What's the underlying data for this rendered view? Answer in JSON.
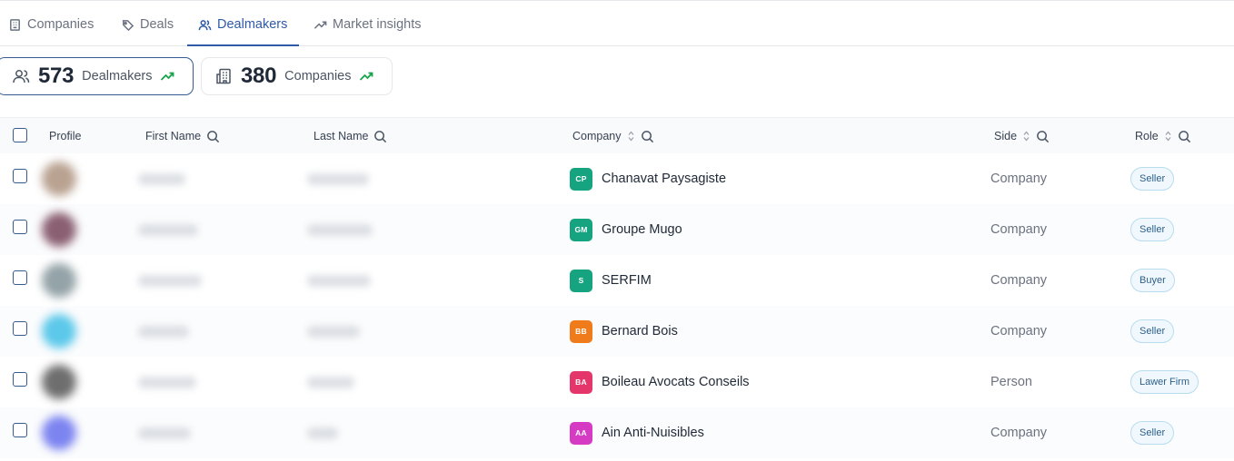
{
  "tabs": [
    {
      "label": "Companies",
      "icon": "building-icon"
    },
    {
      "label": "Deals",
      "icon": "tag-icon"
    },
    {
      "label": "Dealmakers",
      "icon": "users-icon",
      "active": true
    },
    {
      "label": "Market insights",
      "icon": "trend-icon"
    }
  ],
  "stats": {
    "dealmakers": {
      "value": "573",
      "label": "Dealmakers"
    },
    "companies": {
      "value": "380",
      "label": "Companies"
    }
  },
  "table": {
    "columns": {
      "profile": "Profile",
      "first_name": "First Name",
      "last_name": "Last Name",
      "company": "Company",
      "side": "Side",
      "role": "Role"
    },
    "rows": [
      {
        "logo_initials": "CP",
        "logo_color": "#16a37f",
        "company": "Chanavat Paysagiste",
        "side": "Company",
        "role": "Seller",
        "avatar_color": "#b9a291"
      },
      {
        "logo_initials": "GM",
        "logo_color": "#16a37f",
        "company": "Groupe Mugo",
        "side": "Company",
        "role": "Seller",
        "avatar_color": "#8a5f72"
      },
      {
        "logo_initials": "S",
        "logo_color": "#16a37f",
        "company": "SERFIM",
        "side": "Company",
        "role": "Buyer",
        "avatar_color": "#94a3a8"
      },
      {
        "logo_initials": "BB",
        "logo_color": "#f07b1a",
        "company": "Bernard Bois",
        "side": "Company",
        "role": "Seller",
        "avatar_color": "#5cc8ea"
      },
      {
        "logo_initials": "BA",
        "logo_color": "#e5366b",
        "company": "Boileau Avocats Conseils",
        "side": "Person",
        "role": "Lawer Firm",
        "avatar_color": "#6e6e6e"
      },
      {
        "logo_initials": "AA",
        "logo_color": "#d63bc4",
        "company": "Ain Anti-Nuisibles",
        "side": "Company",
        "role": "Seller",
        "avatar_color": "#7c84f0"
      }
    ]
  },
  "colors": {
    "accent": "#2f5aa8",
    "trend_green": "#16a34a",
    "role_badge_text": "#2d5f8a"
  }
}
